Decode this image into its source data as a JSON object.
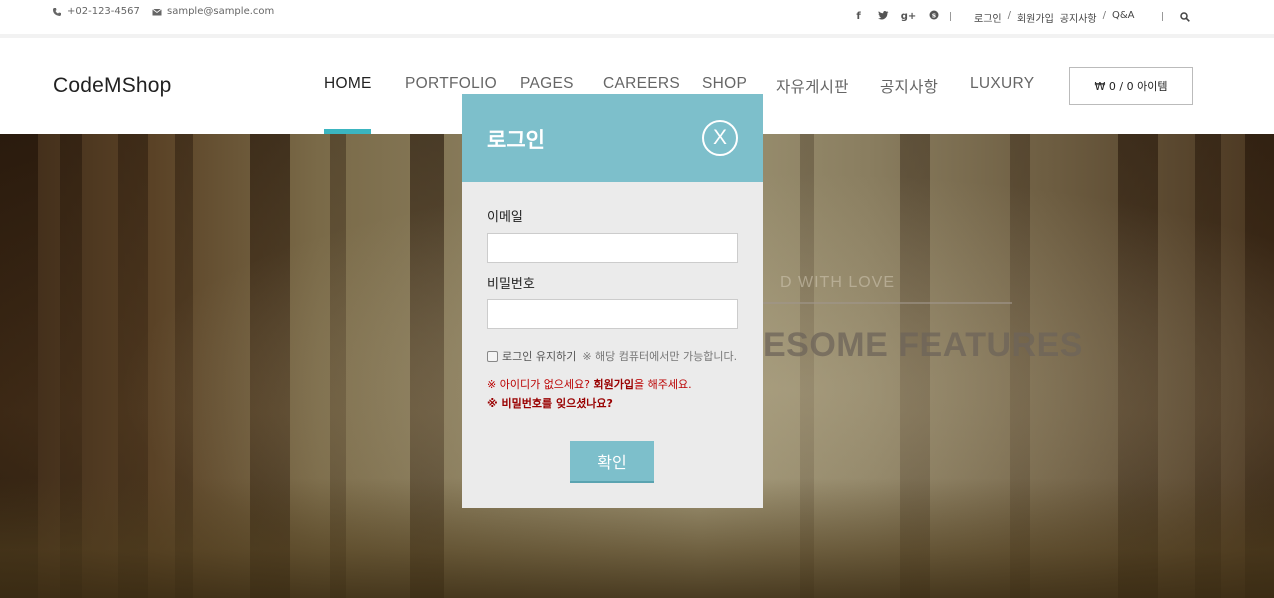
{
  "topbar": {
    "phone": "+02-123-4567",
    "email": "sample@sample.com",
    "social": [
      "f",
      "t",
      "g+",
      "s"
    ],
    "links": [
      "로그인",
      "회원가입",
      "공지사항",
      "Q&A"
    ],
    "sep": "/"
  },
  "header": {
    "logo": "CodeMShop",
    "nav": [
      "HOME",
      "PORTFOLIO",
      "PAGES",
      "CAREERS",
      "SHOP",
      "자유게시판",
      "공지사항",
      "LUXURY"
    ],
    "cart": "₩ 0 / 0 아이템"
  },
  "hero": {
    "subtitle": "D WITH LOVE",
    "title": "ESOME FEATURES"
  },
  "modal": {
    "title": "로그인",
    "close": "X",
    "email_label": "이메일",
    "email_value": "",
    "password_label": "비밀번호",
    "password_value": "",
    "remember_label": "로그인 유지하기",
    "remember_note": "※ 해당 컴퓨터에서만 가능합니다.",
    "signup_prefix": "※ 아이디가 없으세요? ",
    "signup_link": "회원가입",
    "signup_suffix": "을 해주세요.",
    "forgot": "※ 비밀번호를 잊으셨나요?",
    "confirm": "확인"
  },
  "colors": {
    "accent": "#7dbfcb",
    "nav_active": "#3bb5c0",
    "notice_red": "#b00000"
  }
}
